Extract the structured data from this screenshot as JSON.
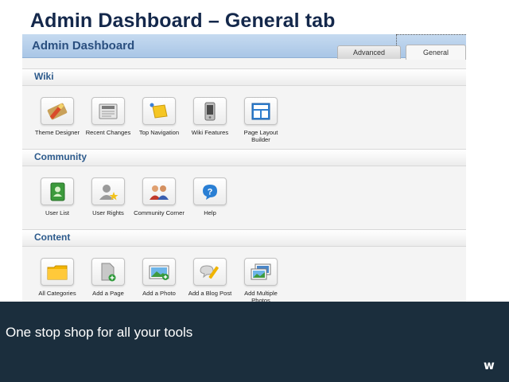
{
  "slide": {
    "title": "Admin Dashboard – General tab"
  },
  "dashboard": {
    "title": "Admin Dashboard",
    "tabs": [
      {
        "label": "Advanced"
      },
      {
        "label": "General"
      }
    ],
    "selected_tab": "General",
    "sections": [
      {
        "label": "Wiki",
        "tools": [
          {
            "label": "Theme Designer",
            "icon": "theme-designer-icon"
          },
          {
            "label": "Recent Changes",
            "icon": "newspaper-icon"
          },
          {
            "label": "Top Navigation",
            "icon": "navigation-tag-icon"
          },
          {
            "label": "Wiki Features",
            "icon": "phone-features-icon"
          },
          {
            "label": "Page Layout Builder",
            "icon": "layout-icon"
          }
        ]
      },
      {
        "label": "Community",
        "tools": [
          {
            "label": "User List",
            "icon": "address-book-icon"
          },
          {
            "label": "User Rights",
            "icon": "user-star-icon"
          },
          {
            "label": "Community Corner",
            "icon": "people-icon"
          },
          {
            "label": "Help",
            "icon": "help-icon"
          }
        ]
      },
      {
        "label": "Content",
        "tools": [
          {
            "label": "All Categories",
            "icon": "folder-icon"
          },
          {
            "label": "Add a Page",
            "icon": "add-page-icon"
          },
          {
            "label": "Add a Photo",
            "icon": "add-photo-icon"
          },
          {
            "label": "Add a Blog Post",
            "icon": "blog-post-icon"
          },
          {
            "label": "Add Multiple Photos",
            "icon": "multiple-photos-icon"
          }
        ]
      }
    ]
  },
  "banner": {
    "text": "One stop shop for all your tools",
    "logo": "w"
  },
  "colors": {
    "header": "#a9c6e6",
    "section_text": "#2c5a8c",
    "banner": "#1b2e3d",
    "title": "#14284b"
  }
}
